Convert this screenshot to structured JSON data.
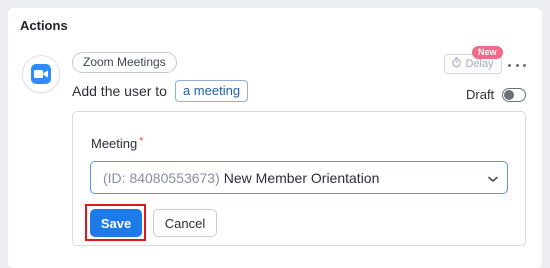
{
  "section": {
    "title": "Actions"
  },
  "step": {
    "app_icon": "zoom-camera-icon",
    "app_name": "Zoom Meetings",
    "description_prefix": "Add the user to",
    "description_token": "a meeting",
    "new_badge": "New",
    "delay_label": "Delay",
    "more_icon": "more-horizontal-icon",
    "draft_label": "Draft",
    "draft_enabled": false
  },
  "form": {
    "field_label": "Meeting",
    "required_mark": "*",
    "selected_id": "(ID: 84080553673)",
    "selected_name": "New Member Orientation",
    "save_label": "Save",
    "cancel_label": "Cancel"
  },
  "colors": {
    "accent": "#1c7be6",
    "zoom_blue": "#2d8cff",
    "badge_pink": "#f06a8a",
    "highlight_red": "#e3151e"
  }
}
